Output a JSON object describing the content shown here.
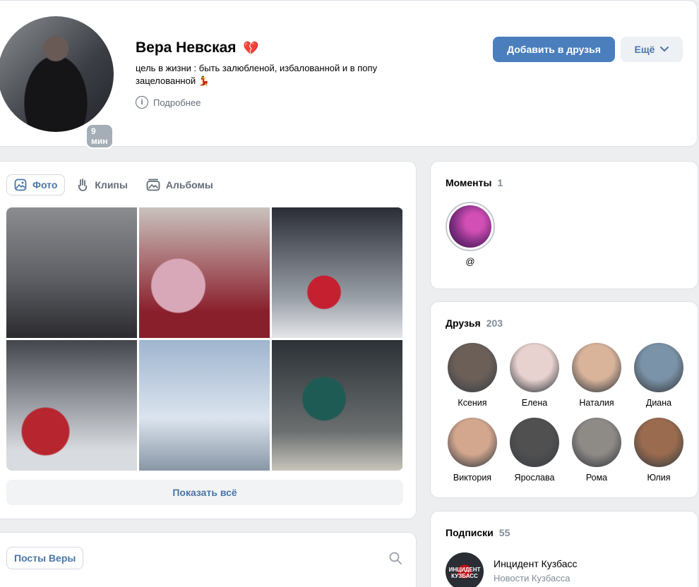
{
  "profile": {
    "name": "Вера Невская",
    "heart_emoji": "💔",
    "status": "цель в жизни : быть залюбленой, избалованной и в попу зацелованной 💃",
    "online": "9 мин",
    "more_info": "Подробнее",
    "add_friend": "Добавить в друзья",
    "more": "Ещё"
  },
  "media_tabs": [
    {
      "label": "Фото",
      "icon": "photo-icon"
    },
    {
      "label": "Клипы",
      "icon": "clips-icon"
    },
    {
      "label": "Альбомы",
      "icon": "albums-icon"
    }
  ],
  "photos_show_all": "Показать всё",
  "posts": {
    "tab": "Посты Веры",
    "search_icon": "search-icon"
  },
  "moments": {
    "title": "Моменты",
    "count": "1",
    "items": [
      {
        "label": "@"
      }
    ]
  },
  "friends": {
    "title": "Друзья",
    "count": "203",
    "items": [
      {
        "name": "Ксения",
        "color": "#6b5f58"
      },
      {
        "name": "Елена",
        "color": "#e8d2cf"
      },
      {
        "name": "Наталия",
        "color": "#d9b49a"
      },
      {
        "name": "Диана",
        "color": "#7a93a8"
      },
      {
        "name": "Виктория",
        "color": "#d3a78e"
      },
      {
        "name": "Ярослава",
        "color": "#505050"
      },
      {
        "name": "Рома",
        "color": "#8e8a86"
      },
      {
        "name": "Юлия",
        "color": "#9a6b4e"
      }
    ]
  },
  "subscriptions": {
    "title": "Подписки",
    "count": "55",
    "items": [
      {
        "name": "Инцидент Кузбасс",
        "desc": "Новости Кузбасса",
        "logo_text": "ИНЦИДЕНТ КУЗБАСС"
      }
    ]
  }
}
